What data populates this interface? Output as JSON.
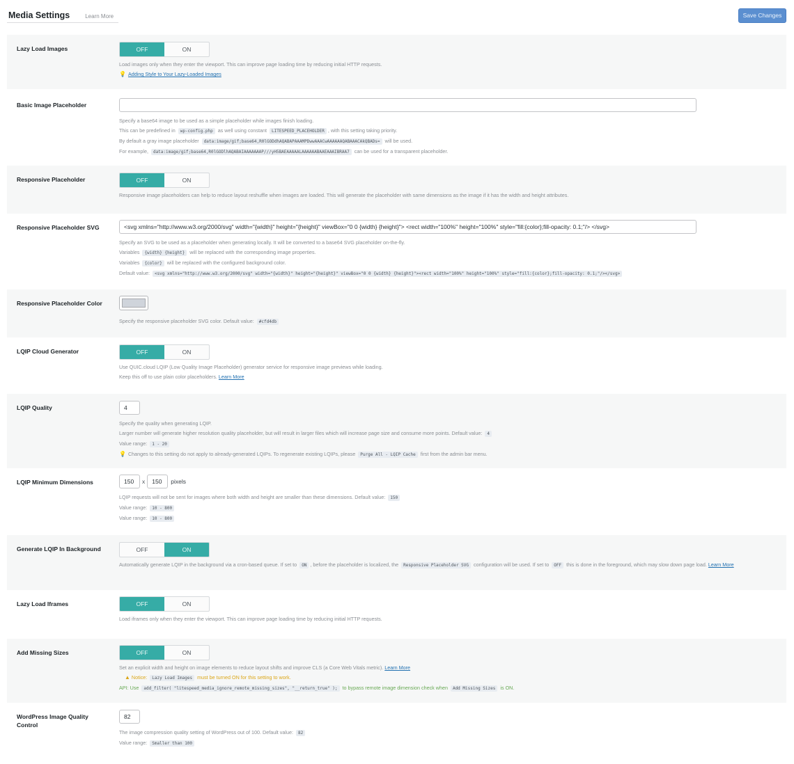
{
  "header": {
    "title": "Media Settings",
    "learn_more": "Learn More",
    "save_label": "Save Changes"
  },
  "toggle_labels": {
    "off": "OFF",
    "on": "ON"
  },
  "settings": {
    "lazy_load_images": {
      "label": "Lazy Load Images",
      "value": "OFF",
      "desc": "Load images only when they enter the viewport. This can improve page loading time by reducing initial HTTP requests.",
      "tip_link": "Adding Style to Your Lazy-Loaded Images"
    },
    "basic_placeholder": {
      "label": "Basic Image Placeholder",
      "value": "",
      "desc1": "Specify a base64 image to be used as a simple placeholder while images finish loading.",
      "desc2a": "This can be predefined in",
      "desc2_code1": "wp-config.php",
      "desc2b": "as well using constant",
      "desc2_code2": "LITESPEED_PLACEHOLDER",
      "desc2c": ", with this setting taking priority.",
      "desc3a": "By default a gray image placeholder",
      "desc3_code": "data:image/gif;base64,R0lGODdhAQABAPAAAMPDwwAAACwAAAAAAQABAAACAkQBADs=",
      "desc3b": "will be used.",
      "desc4a": "For example,",
      "desc4_code": "data:image/gif;base64,R0lGODlhAQABAIAAAAAAAP///yH5BAEAAAAALAAAAAABAAEAAAIBRAA7",
      "desc4b": "can be used for a transparent placeholder."
    },
    "responsive_placeholder": {
      "label": "Responsive Placeholder",
      "value": "OFF",
      "desc": "Responsive image placeholders can help to reduce layout reshuffle when images are loaded. This will generate the placeholder with same dimensions as the image if it has the width and height attributes."
    },
    "responsive_placeholder_svg": {
      "label": "Responsive Placeholder SVG",
      "value": "<svg xmlns=\"http://www.w3.org/2000/svg\" width=\"{width}\" height=\"{height}\" viewBox=\"0 0 {width} {height}\"> <rect width=\"100%\" height=\"100%\" style=\"fill:{color};fill-opacity: 0.1;\"/> </svg>",
      "desc1": "Specify an SVG to be used as a placeholder when generating locally. It will be converted to a base64 SVG placeholder on-the-fly.",
      "desc2a": "Variables",
      "desc2_code": "{width} {height}",
      "desc2b": "will be replaced with the corresponding image properties.",
      "desc3a": "Variables",
      "desc3_code": "{color}",
      "desc3b": "will be replaced with the configured background color.",
      "desc4a": "Default value:",
      "desc4_code": "<svg xmlns=\"http://www.w3.org/2000/svg\" width=\"{width}\" height=\"{height}\" viewBox=\"0 0 {width} {height}\"><rect width=\"100%\" height=\"100%\" style=\"fill:{color};fill-opacity: 0.1;\"/></svg>"
    },
    "responsive_placeholder_color": {
      "label": "Responsive Placeholder Color",
      "value": "#cfd4db",
      "desc": "Specify the responsive placeholder SVG color. Default value:",
      "default_code": "#cfd4db"
    },
    "lqip_cloud_generator": {
      "label": "LQIP Cloud Generator",
      "value": "OFF",
      "desc1": "Use QUIC.cloud LQIP (Low Quality Image Placeholder) generator service for responsive image previews while loading.",
      "desc2": "Keep this off to use plain color placeholders.",
      "learn_more": "Learn More"
    },
    "lqip_quality": {
      "label": "LQIP Quality",
      "value": "4",
      "desc1": "Specify the quality when generating LQIP.",
      "desc2": "Larger number will generate higher resolution quality placeholder, but will result in larger files which will increase page size and consume more points. Default value:",
      "default_code": "4",
      "range_label": "Value range:",
      "range_code": "1 - 20",
      "tip_a": "Changes to this setting do not apply to already-generated LQIPs. To regenerate existing LQIPs, please",
      "tip_code": "Purge All - LQIP Cache",
      "tip_b": "first from the admin bar menu."
    },
    "lqip_min_dimensions": {
      "label": "LQIP Minimum Dimensions",
      "width": "150",
      "height": "150",
      "times": "x",
      "unit": "pixels",
      "desc": "LQIP requests will not be sent for images where both width and height are smaller than these dimensions. Default value:",
      "default_code": "150",
      "range_label": "Value range:",
      "range_code1": "10 - 800",
      "range_code2": "10 - 800"
    },
    "generate_lqip_background": {
      "label": "Generate LQIP In Background",
      "value": "ON",
      "desc_a": "Automatically generate LQIP in the background via a cron-based queue. If set to",
      "desc_code1": "ON",
      "desc_b": ", before the placeholder is localized, the",
      "desc_code2": "Responsive Placeholder SVG",
      "desc_c": "configuration will be used. If set to",
      "desc_code3": "OFF",
      "desc_d": "this is done in the foreground, which may slow down page load.",
      "learn_more": "Learn More"
    },
    "lazy_load_iframes": {
      "label": "Lazy Load Iframes",
      "value": "OFF",
      "desc": "Load iframes only when they enter the viewport. This can improve page loading time by reducing initial HTTP requests."
    },
    "add_missing_sizes": {
      "label": "Add Missing Sizes",
      "value": "OFF",
      "desc": "Set an explicit width and height on image elements to reduce layout shifts and improve CLS (a Core Web Vitals metric).",
      "learn_more": "Learn More",
      "notice_label": "Notice:",
      "notice_code": "Lazy Load Images",
      "notice_text": "must be turned ON for this setting to work.",
      "api_label": "API: Use",
      "api_code": "add_filter( \"litespeed_media_ignore_remote_missing_sizes\", \"__return_true\" );",
      "api_text": "to bypass remote image dimension check when",
      "api_code2": "Add Missing Sizes",
      "api_text2": "is ON."
    },
    "wp_image_quality": {
      "label": "WordPress Image Quality Control",
      "value": "82",
      "desc": "The image compression quality setting of WordPress out of 100. Default value:",
      "default_code": "82",
      "range_label": "Value range:",
      "range_code": "Smaller than 100"
    }
  }
}
